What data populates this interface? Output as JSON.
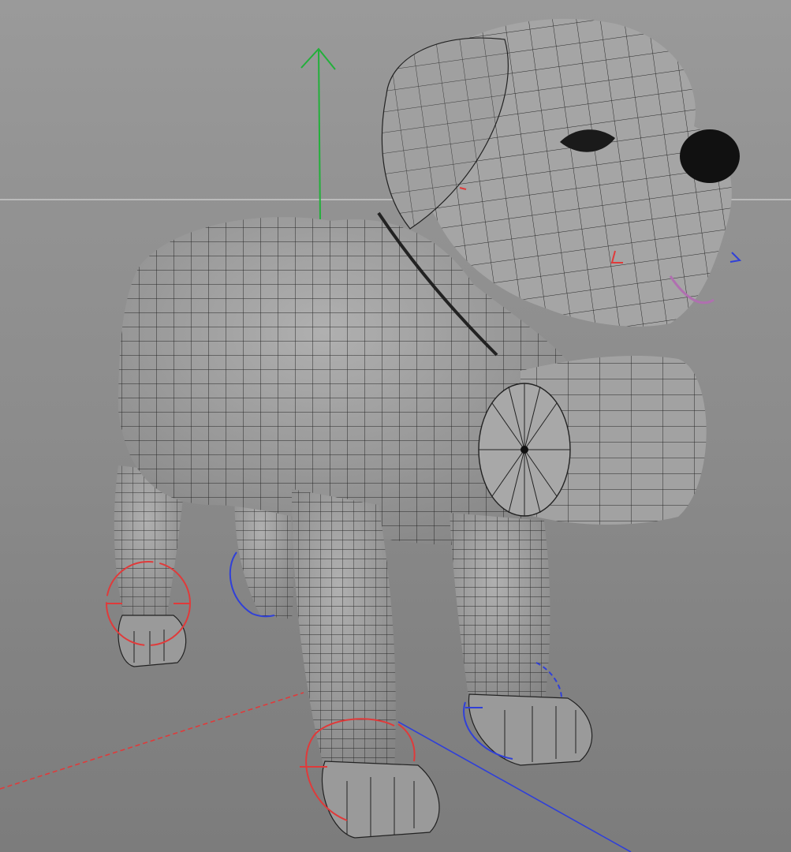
{
  "viewport": {
    "background_color": "#8f8f8f",
    "horizon_color": "#c8c8c8"
  },
  "scene": {
    "model": "dog",
    "accessory": "barrel",
    "mesh_fill_color": "#9b9b9b",
    "wire_color": "#1f1f1f",
    "nose_color": "#111111"
  },
  "axes": {
    "x_color": "#e03a3a",
    "y_color": "#22b03a",
    "z_color": "#3040d8"
  },
  "joint_handles": [
    {
      "name": "front-left-paw",
      "color": "#e03a3a"
    },
    {
      "name": "front-right-paw",
      "color": "#e03a3a"
    },
    {
      "name": "back-left-paw",
      "color": "#3040d8"
    },
    {
      "name": "back-right-paw",
      "color": "#3040d8"
    }
  ],
  "icons": [
    "y-axis-arrow-icon",
    "joint-handle-icon"
  ]
}
